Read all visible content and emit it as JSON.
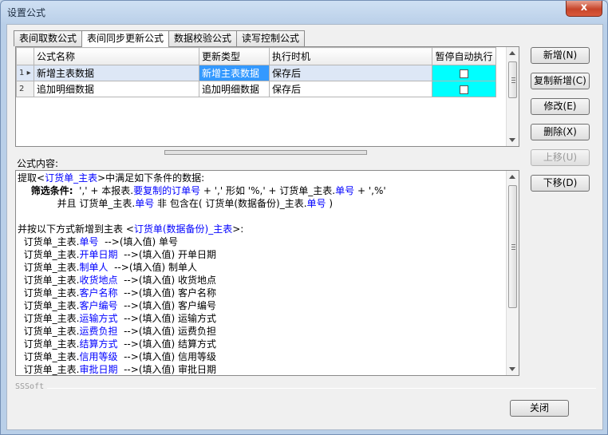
{
  "window": {
    "title": "设置公式",
    "close_glyph": "x"
  },
  "tabs": [
    {
      "label": "表间取数公式",
      "active": false
    },
    {
      "label": "表间同步更新公式",
      "active": true
    },
    {
      "label": "数据校验公式",
      "active": false
    },
    {
      "label": "读写控制公式",
      "active": false
    }
  ],
  "grid": {
    "columns": [
      "公式名称",
      "更新类型",
      "执行时机",
      "暂停自动执行"
    ],
    "rows": [
      {
        "num": "1",
        "marker": "▸",
        "name": "新增主表数据",
        "type": "新增主表数据",
        "timing": "保存后"
      },
      {
        "num": "2",
        "marker": "",
        "name": "追加明细数据",
        "type": "追加明细数据",
        "timing": "保存后"
      }
    ]
  },
  "content_label": "公式内容:",
  "formula": {
    "l1_a": "提取<",
    "l1_b": "订货单_主表",
    "l1_c": ">中满足如下条件的数据:",
    "l2_a": "    筛选条件:",
    "l2_b": "  ',' + 本报表.",
    "l2_c": "要复制的订单号",
    "l2_d": " + ',' 形如 '%,' + 订货单_主表.",
    "l2_e": "单号",
    "l2_f": " + ',%'",
    "l3_a": "             并且 订货单_主表.",
    "l3_b": "单号",
    "l3_c": " 非 包含在( 订货单(数据备份)_主表.",
    "l3_d": "单号",
    "l3_e": " )",
    "l5_a": "并按以下方式新增到主表 <",
    "l5_b": "订货单(数据备份)_主表",
    "l5_c": ">:",
    "mappings": [
      {
        "prefix": "  订货单_主表.",
        "field": "单号",
        "arrow": "  -->(填入值) 单号"
      },
      {
        "prefix": "  订货单_主表.",
        "field": "开单日期",
        "arrow": "  -->(填入值) 开单日期"
      },
      {
        "prefix": "  订货单_主表.",
        "field": "制单人",
        "arrow": "  -->(填入值) 制单人"
      },
      {
        "prefix": "  订货单_主表.",
        "field": "收货地点",
        "arrow": "  -->(填入值) 收货地点"
      },
      {
        "prefix": "  订货单_主表.",
        "field": "客户名称",
        "arrow": "  -->(填入值) 客户名称"
      },
      {
        "prefix": "  订货单_主表.",
        "field": "客户编号",
        "arrow": "  -->(填入值) 客户编号"
      },
      {
        "prefix": "  订货单_主表.",
        "field": "运输方式",
        "arrow": "  -->(填入值) 运输方式"
      },
      {
        "prefix": "  订货单_主表.",
        "field": "运费负担",
        "arrow": "  -->(填入值) 运费负担"
      },
      {
        "prefix": "  订货单_主表.",
        "field": "结算方式",
        "arrow": "  -->(填入值) 结算方式"
      },
      {
        "prefix": "  订货单_主表.",
        "field": "信用等级",
        "arrow": "  -->(填入值) 信用等级"
      },
      {
        "prefix": "  订货单_主表.",
        "field": "审批日期",
        "arrow": "  -->(填入值) 审批日期"
      }
    ]
  },
  "buttons": {
    "add": "新增(N)",
    "copy_add": "复制新增(C)",
    "modify": "修改(E)",
    "delete": "删除(X)",
    "move_up": "上移(U)",
    "move_down": "下移(D)",
    "close": "关闭"
  },
  "brand": "SSSoft",
  "colors": {
    "selected_cell": "#3399ff",
    "checkbox_cell": "#00ffff",
    "highlight_text": "#0000ff"
  }
}
